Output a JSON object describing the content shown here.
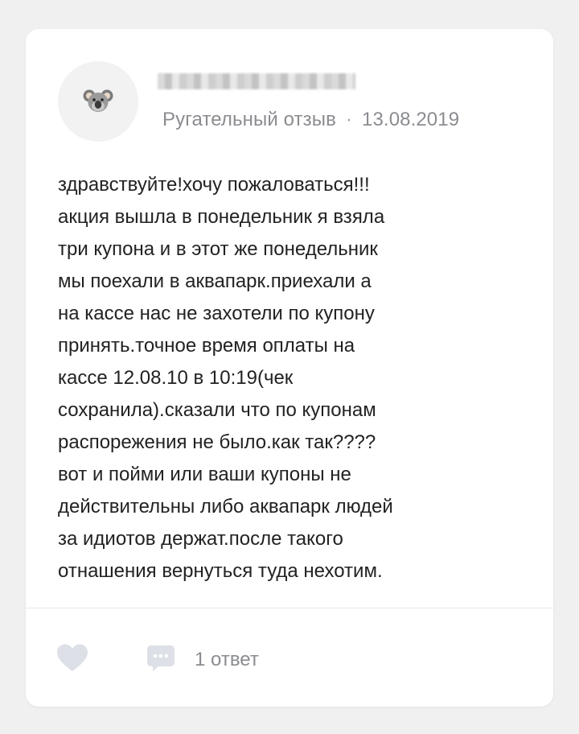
{
  "review": {
    "author_name_visible": false,
    "avatar_icon": "koala-icon",
    "review_type": "Ругательный отзыв",
    "separator": "·",
    "date": "13.08.2019",
    "text_lines": [
      "здравствуйте!хочу пожаловаться!!!",
      "акция вышла в понедельник я взяла",
      "три купона и в этот же понедельник",
      "мы поехали в аквапарк.приехали а",
      "на кассе нас не захотели по купону",
      "принять.точное время оплаты на",
      "кассе 12.08.10 в 10:19(чек",
      "сохранила).сказали что по купонам",
      "распорежения не было.как так????",
      "вот и пойми или ваши купоны не",
      "действительны либо аквапарк людей",
      "за идиотов держат.после такого",
      "отнашения вернуться туда нехотим."
    ]
  },
  "actions": {
    "like_icon": "heart-icon",
    "reply_icon": "comment-icon",
    "reply_label": "1 ответ"
  },
  "colors": {
    "background": "#f0f0f1",
    "card": "#ffffff",
    "text": "#222222",
    "muted": "#8a8c90",
    "icon": "#dde0e6"
  }
}
